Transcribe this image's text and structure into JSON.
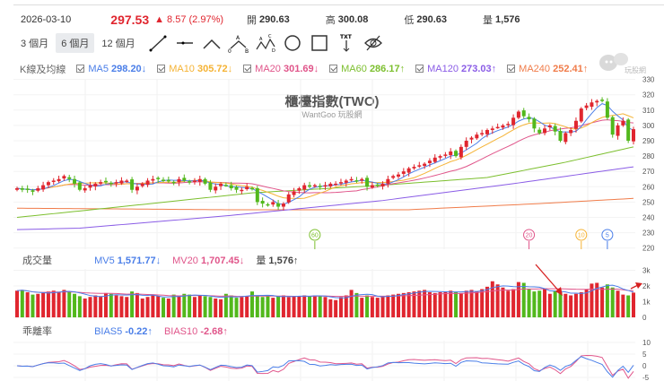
{
  "header": {
    "date": "2026-03-10",
    "price": "297.53",
    "change": "▲ 8.57 (2.97%)",
    "open_label": "開",
    "open": "290.63",
    "high_label": "高",
    "high": "300.08",
    "low_label": "低",
    "low": "290.63",
    "vol_label": "量",
    "vol": "1,576"
  },
  "toolbar": {
    "ranges": [
      "3 個月",
      "6 個月",
      "12 個月"
    ],
    "active_range": "6 個月",
    "tools": [
      "trend-line",
      "horizontal-line",
      "angle",
      "abc-pattern",
      "abcd-pattern",
      "circle",
      "rectangle",
      "text-arrow",
      "hide-drawings"
    ],
    "txt_label": "TXT"
  },
  "ma_legend": {
    "label": "K線及均線",
    "items": [
      {
        "name": "MA5",
        "value": "298.20↓",
        "color": "#4a7ee8"
      },
      {
        "name": "MA10",
        "value": "305.72↓",
        "color": "#f5b335"
      },
      {
        "name": "MA20",
        "value": "301.69↓",
        "color": "#e0558a"
      },
      {
        "name": "MA60",
        "value": "286.17↑",
        "color": "#7cbf2e"
      },
      {
        "name": "MA120",
        "value": "273.03↑",
        "color": "#8a5ce6"
      },
      {
        "name": "MA240",
        "value": "252.41↑",
        "color": "#f07c4a"
      }
    ]
  },
  "title": "櫃檯指數(TWO)",
  "subtitle": "WantGoo 玩股網",
  "logo_text": "玩股網",
  "volume_legend": {
    "label": "成交量",
    "mv5": "MV5",
    "mv5_value": "1,571.77↓",
    "mv20": "MV20",
    "mv20_value": "1,707.45↓",
    "vol": "量",
    "vol_value": "1,576↑"
  },
  "bias_legend": {
    "label": "乖離率",
    "b5": "BIAS5",
    "b5_value": "-0.22↑",
    "b10": "BIAS10",
    "b10_value": "-2.68↑"
  },
  "colors": {
    "up": "#e0262f",
    "down": "#52b81c"
  },
  "chart_data": [
    {
      "type": "candlestick",
      "title": "櫃檯指數(TWO)",
      "y_ticks": [
        330,
        320,
        310,
        300,
        290,
        280,
        270,
        260,
        250,
        240,
        230,
        220
      ],
      "ylim": [
        220,
        330
      ],
      "closes": [
        259,
        258,
        258,
        257,
        259,
        261,
        263,
        264,
        265,
        267,
        265,
        262,
        258,
        259,
        261,
        262,
        263,
        263,
        262,
        263,
        264,
        264,
        258,
        260,
        262,
        264,
        265,
        265,
        264,
        264,
        263,
        265,
        264,
        263,
        264,
        265,
        262,
        258,
        260,
        262,
        261,
        259,
        258,
        258,
        260,
        259,
        250,
        249,
        248,
        250,
        247,
        249,
        255,
        257,
        259,
        261,
        260,
        261,
        260,
        261,
        262,
        262,
        263,
        264,
        265,
        264,
        265,
        260,
        261,
        261,
        262,
        265,
        267,
        268,
        270,
        272,
        273,
        274,
        275,
        277,
        279,
        280,
        281,
        283,
        280,
        286,
        290,
        292,
        294,
        295,
        297,
        298,
        299,
        300,
        301,
        305,
        309,
        306,
        304,
        298,
        295,
        298,
        300,
        296,
        290,
        295,
        297,
        303,
        311,
        313,
        315,
        316,
        316,
        305,
        294,
        300,
        303,
        290,
        297.53
      ],
      "long_ma": {
        "MA60": [
          [
            0,
            240
          ],
          [
            20,
            247
          ],
          [
            45,
            256
          ],
          [
            70,
            261
          ],
          [
            90,
            266
          ],
          [
            105,
            276
          ],
          [
            118,
            286
          ]
        ],
        "MA120": [
          [
            0,
            232
          ],
          [
            12,
            233
          ],
          [
            40,
            241
          ],
          [
            70,
            251
          ],
          [
            95,
            262
          ],
          [
            118,
            273
          ]
        ],
        "MA240": [
          [
            0,
            246
          ],
          [
            40,
            245
          ],
          [
            75,
            245
          ],
          [
            100,
            249
          ],
          [
            118,
            252.4
          ]
        ]
      },
      "cross_markers": [
        {
          "label": "60",
          "index": 57,
          "color": "#7cbf2e"
        },
        {
          "label": "20",
          "index": 98,
          "color": "#e0558a"
        },
        {
          "label": "10",
          "index": 108,
          "color": "#f5b335"
        },
        {
          "label": "5",
          "index": 113,
          "color": "#4a7ee8"
        }
      ]
    },
    {
      "type": "bar",
      "title": "成交量",
      "y_ticks": [
        "3k",
        "2k",
        "1k",
        "0"
      ],
      "ylim": [
        0,
        3000
      ],
      "values": [
        1700,
        1750,
        1600,
        1450,
        1500,
        1550,
        1650,
        1700,
        1600,
        1750,
        1600,
        1500,
        1350,
        1200,
        1300,
        1400,
        1350,
        1550,
        1500,
        1400,
        1350,
        1300,
        1650,
        1550,
        1200,
        1300,
        1400,
        1350,
        1250,
        1200,
        1450,
        1400,
        1500,
        1450,
        1300,
        1400,
        1350,
        1300,
        1200,
        1150,
        1500,
        1400,
        1250,
        1300,
        1350,
        1650,
        1400,
        1300,
        1350,
        1250,
        1350,
        1400,
        1300,
        1350,
        1350,
        1400,
        1350,
        1400,
        1350,
        1300,
        1150,
        1100,
        1300,
        1400,
        1750,
        1550,
        1250,
        1400,
        1300,
        1250,
        1350,
        1400,
        1450,
        1500,
        1550,
        1600,
        1650,
        1700,
        1750,
        1600,
        1550,
        1600,
        1650,
        1700,
        1600,
        1550,
        1700,
        1750,
        1650,
        1800,
        1950,
        2300,
        2100,
        1900,
        1700,
        1800,
        2250,
        2200,
        1800,
        1650,
        1700,
        1800,
        1500,
        1700,
        1600,
        1500,
        1400,
        1500,
        1600,
        1800,
        2150,
        2200,
        1900,
        2100,
        1900,
        1700,
        1450,
        1400,
        1576
      ]
    },
    {
      "type": "line",
      "title": "乖離率",
      "y_ticks": [
        10,
        5,
        0,
        -5
      ],
      "ylim": [
        -5,
        10
      ]
    }
  ]
}
